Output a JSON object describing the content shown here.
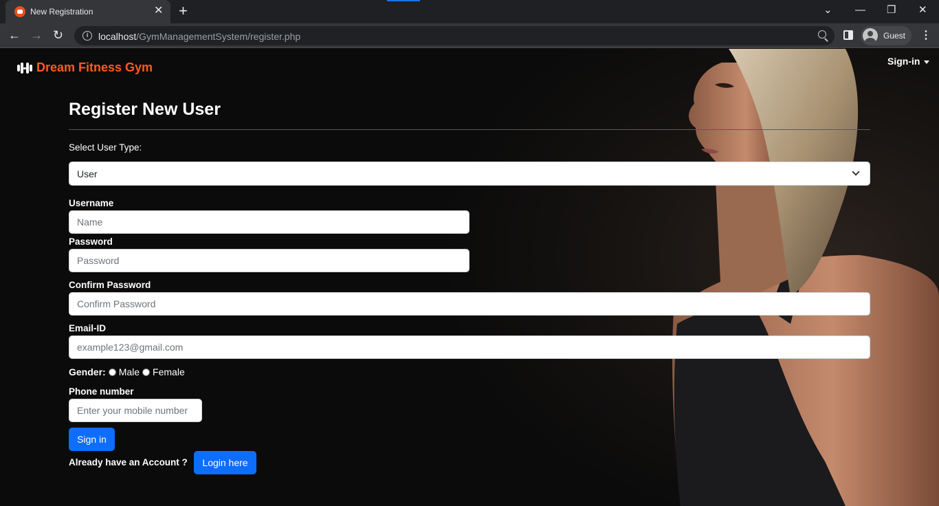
{
  "browser": {
    "tab_title": "New Registration",
    "url_host": "localhost",
    "url_path": "/GymManagementSystem/register.php",
    "profile_name": "Guest"
  },
  "nav": {
    "brand": "Dream Fitness Gym",
    "signin_menu": "Sign-in"
  },
  "form": {
    "heading": "Register New User",
    "user_type_label": "Select User Type:",
    "user_type_value": "User",
    "username_label": "Username",
    "username_placeholder": "Name",
    "password_label": "Password",
    "password_placeholder": "Password",
    "confirm_label": "Confirm Password",
    "confirm_placeholder": "Confirm Password",
    "email_label": "Email-ID",
    "email_placeholder": "example123@gmail.com",
    "gender_label": "Gender:",
    "gender_male": "Male",
    "gender_female": "Female",
    "phone_label": "Phone number",
    "phone_placeholder": "Enter your mobile number",
    "submit_label": "Sign in",
    "account_prompt": "Already have an Account ?",
    "login_label": "Login here"
  },
  "colors": {
    "brand": "#ff5a1f",
    "primary_button": "#0d6efd",
    "background": "#0b0b0b"
  }
}
